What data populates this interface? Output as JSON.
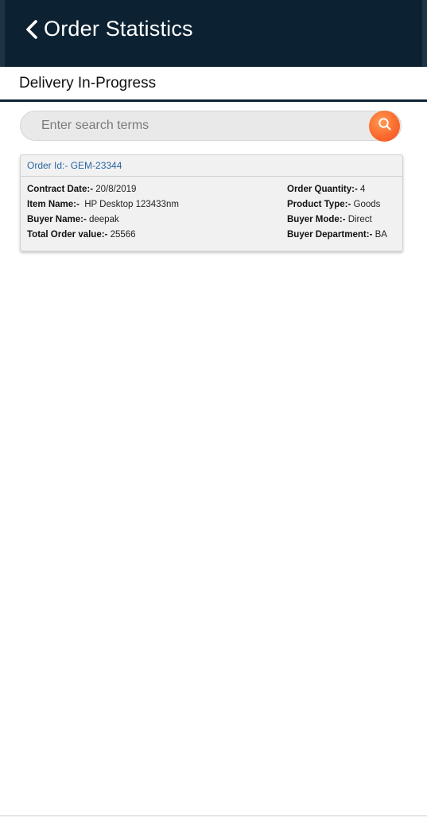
{
  "header": {
    "title": "Order Statistics",
    "back_icon": "chevron-left-icon",
    "background": "#0c2233"
  },
  "section": {
    "title": "Delivery In-Progress"
  },
  "search": {
    "placeholder": "Enter search terms",
    "value": "",
    "button_icon": "search-icon",
    "button_color": "#fb6b2d"
  },
  "order": {
    "order_id_label": "Order Id:-",
    "order_id": "GEM-23344",
    "fields_left": [
      {
        "label": "Contract Date:-",
        "value": "20/8/2019"
      },
      {
        "label": "Item Name:-",
        "value": "HP Desktop 123433nm"
      },
      {
        "label": "Buyer Name:-",
        "value": "deepak"
      },
      {
        "label": "Total Order value:-",
        "value": "25566"
      }
    ],
    "fields_right": [
      {
        "label": "Order Quantity:-",
        "value": "4"
      },
      {
        "label": "Product Type:-",
        "value": "Goods"
      },
      {
        "label": "Buyer Mode:-",
        "value": "Direct"
      },
      {
        "label": "Buyer Department:-",
        "value": "BA"
      }
    ]
  }
}
